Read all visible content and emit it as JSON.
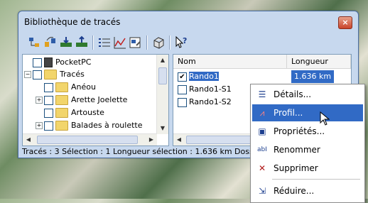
{
  "window": {
    "title": "Bibliothèque de tracés",
    "close_glyph": "×"
  },
  "toolbar": {
    "buttons": [
      "tree-icon",
      "swap-icon",
      "import-icon",
      "export-icon",
      "details-view-icon",
      "profile-icon",
      "properties-icon",
      "3d-view-icon",
      "help-icon"
    ]
  },
  "tree": {
    "items": [
      "PocketPC",
      "Tracés",
      "Anéou",
      "Arette Joelette",
      "Artouste",
      "Balades à roulette"
    ]
  },
  "list": {
    "columns": [
      "Nom",
      "Longueur"
    ],
    "rows": [
      {
        "name": "Rando1",
        "length": "1.636 km",
        "checked": true
      },
      {
        "name": "Rando1-S1",
        "length": "",
        "checked": false
      },
      {
        "name": "Rando1-S2",
        "length": "",
        "checked": false
      }
    ]
  },
  "status": {
    "text": "Tracés : 3 Sélection : 1 Longueur sélection : 1.636 km Doss"
  },
  "menu": {
    "items": [
      {
        "label": "Détails...",
        "icon": "details-icon",
        "glyph": "☰"
      },
      {
        "label": "Profil...",
        "icon": "profile-icon",
        "glyph": "⩘"
      },
      {
        "label": "Propriétés...",
        "icon": "properties-icon",
        "glyph": "▣"
      },
      {
        "label": "Renommer",
        "icon": "rename-icon",
        "glyph": "abI"
      },
      {
        "label": "Supprimer",
        "icon": "delete-icon",
        "glyph": "✕"
      },
      {
        "label": "Réduire...",
        "icon": "reduce-icon",
        "glyph": "⇲"
      }
    ]
  },
  "colors": {
    "accent": "#316ac5",
    "window_bg": "#c7d8ee",
    "delete": "#b01818"
  }
}
